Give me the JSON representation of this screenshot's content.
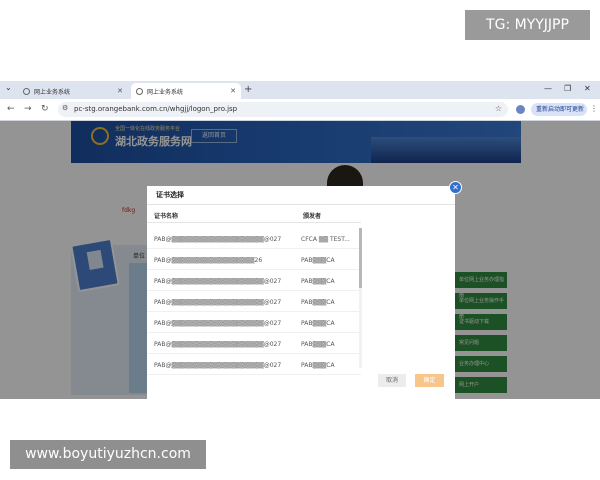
{
  "watermark": {
    "tag": "TG: MYYJJPP",
    "url": "www.boyutiyuzhcn.com"
  },
  "browser": {
    "tabs": [
      {
        "label": "网上业务系统"
      },
      {
        "label": "网上业务系统"
      }
    ],
    "new_tab": "+",
    "address": "pc-stg.orangebank.com.cn/whgjj/logon_pro.jsp",
    "update_button": "重新启动即可更新"
  },
  "page": {
    "banner_title": "湖北政务服务网",
    "banner_subtitle": "全国一体化在线政务服务平台",
    "home_button": "返回首页",
    "panel_tab": "单位",
    "red_text": "fdkg",
    "side_links": [
      "单位网上业务办理指南",
      "单位网上业务操作手册",
      "证书驱动下载",
      "常见问题",
      "业务办理中心",
      "网上开户"
    ]
  },
  "dialog": {
    "title": "证书选择",
    "columns": {
      "name": "证书名称",
      "issuer": "颁发者"
    },
    "rows": [
      {
        "name": "PAB@▒▒▒▒▒▒▒▒▒▒▒▒▒▒▒▒▒▒▒▒@027",
        "issuer": "CFCA ▒▒ TEST..."
      },
      {
        "name": "PAB@▒▒▒▒▒▒▒▒▒▒▒▒▒▒▒▒▒▒26",
        "issuer": "PAB▒▒▒CA"
      },
      {
        "name": "PAB@▒▒▒▒▒▒▒▒▒▒▒▒▒▒▒▒▒▒▒▒@027",
        "issuer": "PAB▒▒▒CA"
      },
      {
        "name": "PAB@▒▒▒▒▒▒▒▒▒▒▒▒▒▒▒▒▒▒▒▒@027",
        "issuer": "PAB▒▒▒CA"
      },
      {
        "name": "PAB@▒▒▒▒▒▒▒▒▒▒▒▒▒▒▒▒▒▒▒▒@027",
        "issuer": "PAB▒▒▒CA"
      },
      {
        "name": "PAB@▒▒▒▒▒▒▒▒▒▒▒▒▒▒▒▒▒▒▒▒@027",
        "issuer": "PAB▒▒▒CA"
      },
      {
        "name": "PAB@▒▒▒▒▒▒▒▒▒▒▒▒▒▒▒▒▒▒▒▒@027",
        "issuer": "PAB▒▒▒CA"
      }
    ],
    "cancel": "取消",
    "confirm": "确定",
    "close": "✕"
  }
}
